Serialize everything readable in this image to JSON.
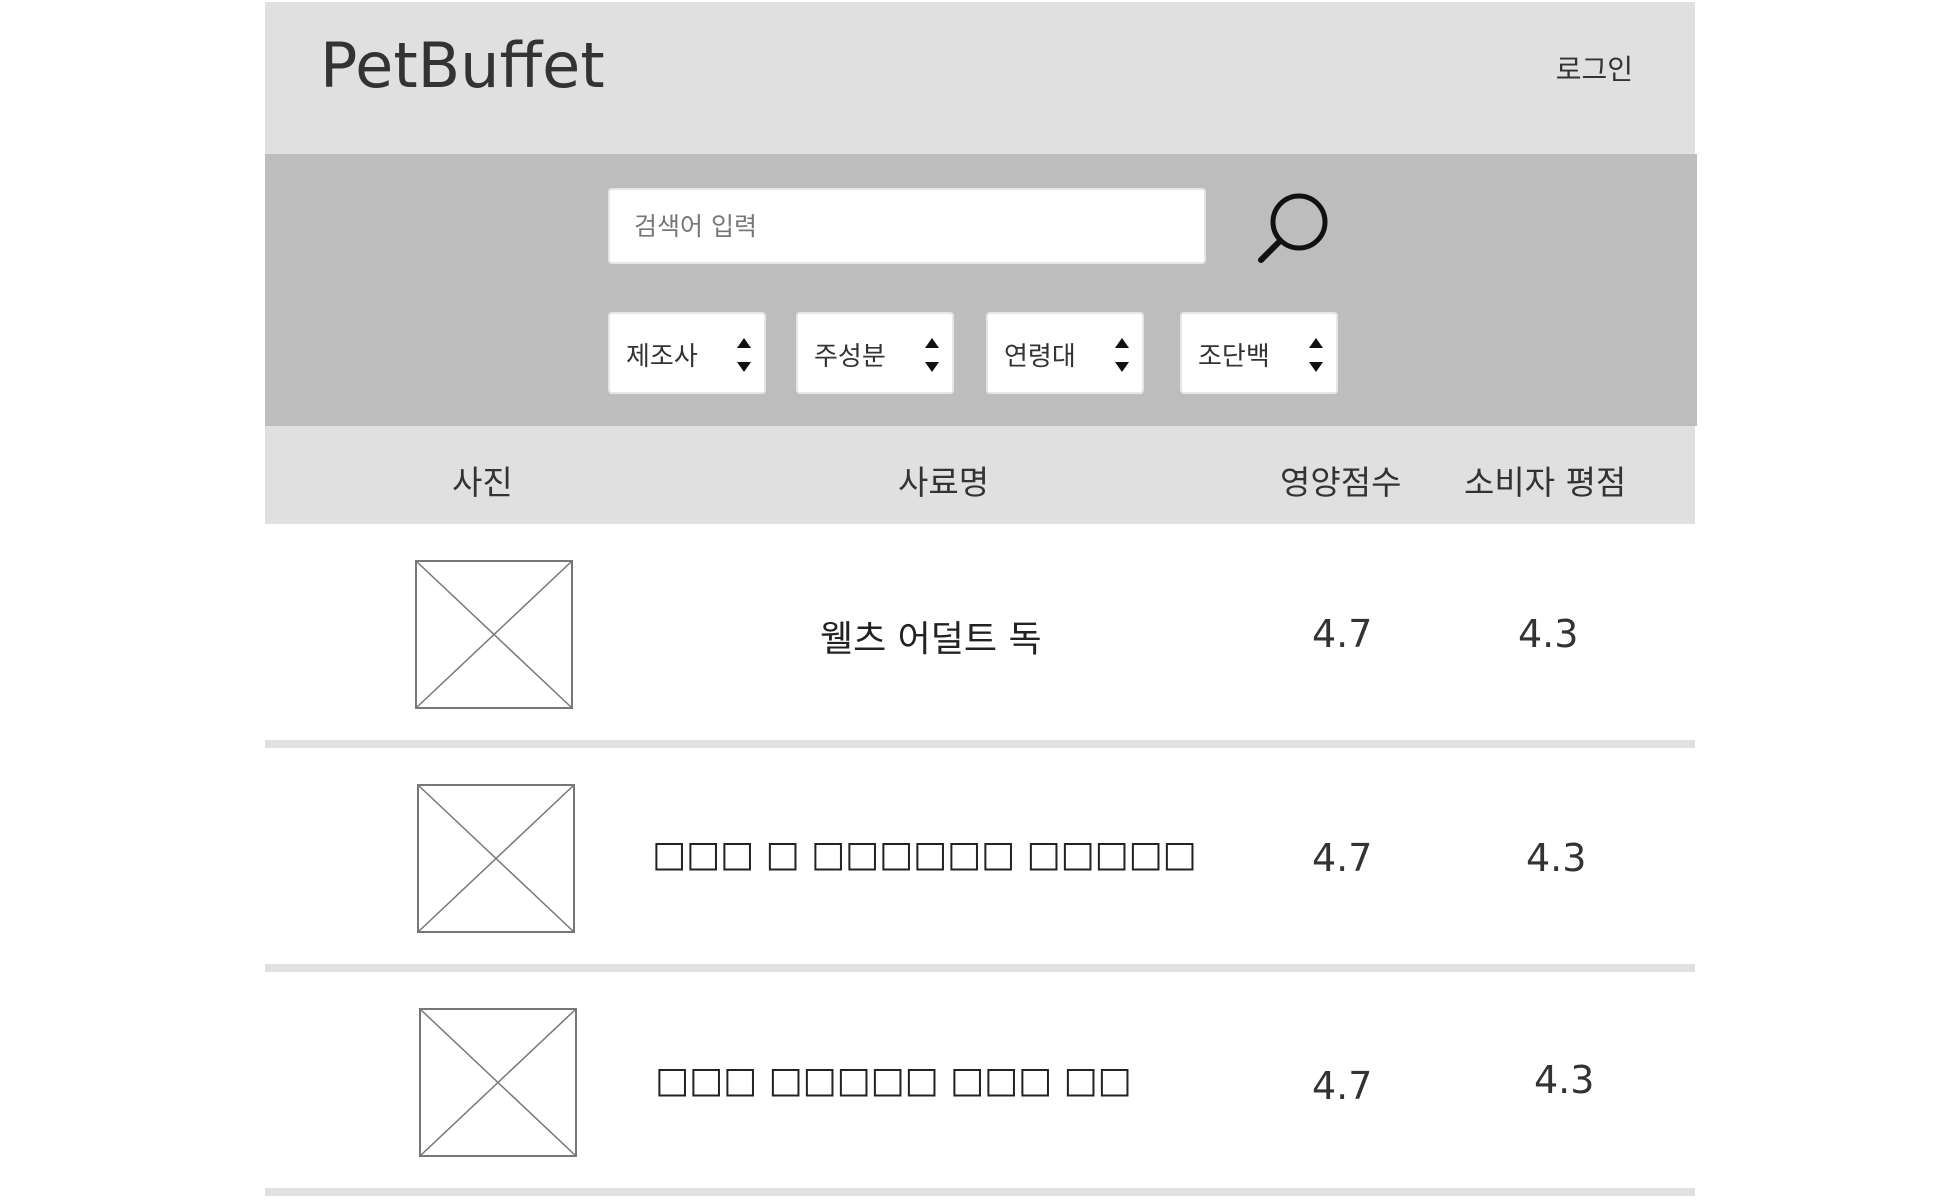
{
  "header": {
    "brand": "PetBuffet",
    "login_label": "로그인"
  },
  "search": {
    "placeholder": "검색어 입력",
    "icon": "search-icon"
  },
  "filters": [
    {
      "label": "제조사",
      "icon": "sort-arrows-icon"
    },
    {
      "label": "주성분",
      "icon": "sort-arrows-icon"
    },
    {
      "label": "연령대",
      "icon": "sort-arrows-icon"
    },
    {
      "label": "조단백",
      "icon": "sort-arrows-icon"
    }
  ],
  "table": {
    "columns": {
      "photo": "사진",
      "name": "사료명",
      "nutrition": "영양점수",
      "rating": "소비자 평점"
    },
    "rows": [
      {
        "name": "웰츠 어덜트 독",
        "nutrition": "4.7",
        "rating": "4.3",
        "image": "image-placeholder-icon"
      },
      {
        "name": "□□□ □ □□□□□□ □□□□□",
        "nutrition": "4.7",
        "rating": "4.3",
        "image": "image-placeholder-icon"
      },
      {
        "name": "□□□ □□□□□ □□□ □□",
        "nutrition": "4.7",
        "rating": "4.3",
        "image": "image-placeholder-icon"
      }
    ]
  },
  "colors": {
    "header_bg": "#e0e0e0",
    "search_band_bg": "#bdbdbd",
    "separator": "#e0e0e0",
    "text": "#333333"
  }
}
